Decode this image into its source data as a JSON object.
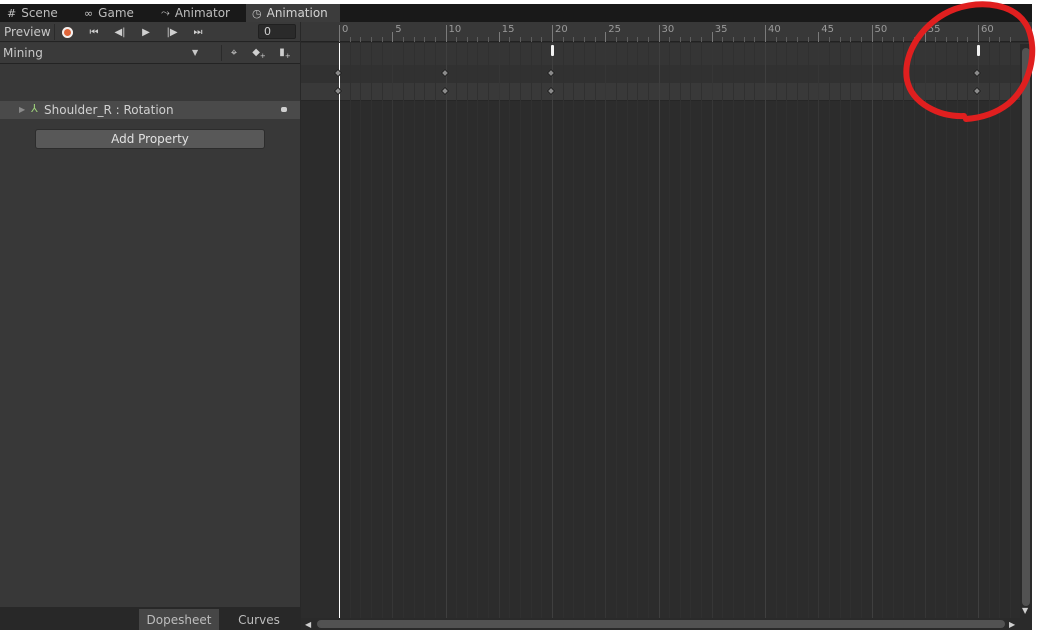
{
  "tabs": [
    {
      "icon": "#",
      "label": "Scene"
    },
    {
      "icon": "∞",
      "label": "Game"
    },
    {
      "icon": "⤳",
      "label": "Animator"
    },
    {
      "icon": "◷",
      "label": "Animation"
    }
  ],
  "toolbar": {
    "preview_label": "Preview",
    "frame_value": "0",
    "buttons": [
      "⏺",
      "⏮",
      "◀|",
      "▶",
      "|▶",
      "⏭"
    ]
  },
  "clip": {
    "name": "Mining"
  },
  "properties": [
    {
      "label": "Shoulder_R : Rotation"
    }
  ],
  "add_property_label": "Add Property",
  "bottom_tabs": [
    "Dopesheet",
    "Curves"
  ],
  "timeline": {
    "tick_labels": [
      "0",
      "5",
      "10",
      "15",
      "20",
      "25",
      "30",
      "35",
      "40",
      "45",
      "50",
      "55",
      "60"
    ],
    "keyframes": [
      0,
      10,
      20,
      60
    ]
  },
  "colors": {
    "record_button": "#e0653a",
    "annotation": "#e01f1f",
    "playhead": "#ffffff"
  }
}
